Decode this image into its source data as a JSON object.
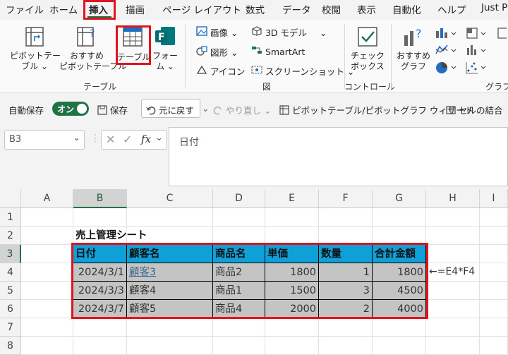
{
  "menubar": {
    "items": [
      "ファイル",
      "ホーム",
      "挿入",
      "描画",
      "ページ レイアウト",
      "数式",
      "データ",
      "校閲",
      "表示",
      "自動化",
      "ヘルプ",
      "Just P"
    ],
    "active_index": 2
  },
  "ribbon": {
    "table_group": {
      "pivot_line1": "ピボットテー",
      "pivot_line2": "ブル ⌄",
      "recommended_line1": "おすすめ",
      "recommended_line2": "ピボットテーブル",
      "table_label": "テーブル",
      "form_line1": "フォー",
      "form_line2": "ム ⌄",
      "group_label": "テーブル"
    },
    "illustrations_group": {
      "image": "画像 ⌄",
      "shapes": "図形 ⌄",
      "icons": "アイコン",
      "model3d": "3D モデル",
      "model3d_arrow": "⌄",
      "smartart": "SmartArt",
      "screenshot": "スクリーンショット ⌄",
      "group_label": "図"
    },
    "controls_group": {
      "checkbox_line1": "チェック",
      "checkbox_line2": "ボックス",
      "group_label": "コントロール"
    },
    "charts_group": {
      "recommended_line1": "おすすめ",
      "recommended_line2": "グラフ",
      "group_label": "グラフ"
    }
  },
  "qat": {
    "autosave_label": "自動保存",
    "autosave_state": "オン",
    "save_label": "保存",
    "undo_label": "元に戻す",
    "redo_label": "やり直し",
    "pivot_wizard_label": "ピボットテーブル/ピボットグラフ ウィザード",
    "merge_label": "セルの結合"
  },
  "formula_bar": {
    "name_box": "B3",
    "fx": "fx",
    "content": "日付"
  },
  "sheet": {
    "columns": [
      "A",
      "B",
      "C",
      "D",
      "E",
      "F",
      "G",
      "H",
      "I"
    ],
    "rows": [
      "1",
      "2",
      "3",
      "4",
      "5",
      "6",
      "7",
      "8"
    ],
    "title": "売上管理シート",
    "headers": [
      "日付",
      "顧客名",
      "商品名",
      "単価",
      "数量",
      "合計金額"
    ],
    "data": [
      [
        "2024/3/1",
        "顧客3",
        "商品2",
        "1800",
        "1",
        "1800"
      ],
      [
        "2024/3/3",
        "顧客4",
        "商品1",
        "1500",
        "3",
        "4500"
      ],
      [
        "2024/3/7",
        "顧客5",
        "商品4",
        "2000",
        "2",
        "4000"
      ]
    ],
    "annotation": "←=E4*F4"
  },
  "colors": {
    "accent": "#217346",
    "highlight": "#e0141e",
    "table_header": "#10a0d8",
    "table_body": "#c4c4c4"
  }
}
